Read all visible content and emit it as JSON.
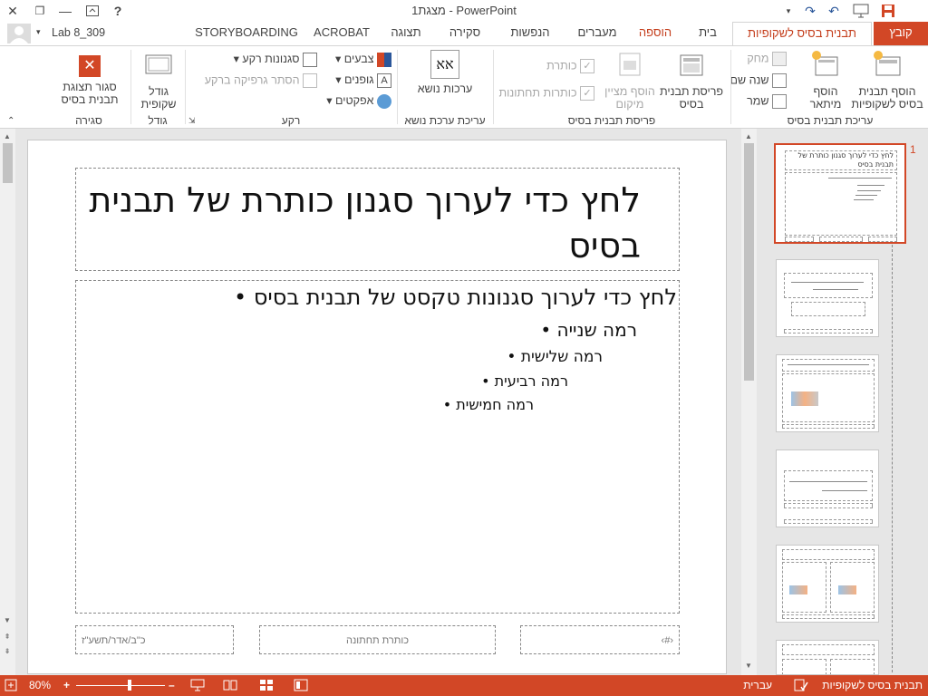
{
  "window": {
    "title": "מצגת1 - PowerPoint",
    "help": "?"
  },
  "user": {
    "name": "Lab 8_309"
  },
  "tabs": [
    {
      "label": "קובץ"
    },
    {
      "label": "תבנית בסיס לשקופיות"
    },
    {
      "label": "בית"
    },
    {
      "label": "הוספה"
    },
    {
      "label": "מעברים"
    },
    {
      "label": "הנפשות"
    },
    {
      "label": "סקירה"
    },
    {
      "label": "תצוגה"
    },
    {
      "label": "ACROBAT"
    },
    {
      "label": "STORYBOARDING"
    }
  ],
  "ribbon": {
    "edit_master": {
      "group_label": "עריכת תבנית בסיס",
      "insert_slide_master": "הוסף תבנית בסיס לשקופיות",
      "insert_layout": "הוסף מיתאר",
      "delete": "מחק",
      "rename": "שנה שם",
      "preserve": "שמר"
    },
    "master_layout": {
      "group_label": "פריסת תבנית בסיס",
      "master_layout": "פריסת תבנית בסיס",
      "insert_placeholder": "הוסף מציין מיקום",
      "title": "כותרת",
      "footers": "כותרות תחתונות"
    },
    "edit_theme": {
      "group_label": "עריכת ערכת נושא",
      "themes": "ערכות נושא",
      "themes_icon_text": "אא"
    },
    "background": {
      "group_label": "רקע",
      "colors": "צבעים",
      "fonts": "גופנים",
      "effects": "אפקטים",
      "background_styles": "סגנונות רקע",
      "hide_bg_graphics": "הסתר גרפיקה ברקע"
    },
    "size": {
      "group_label": "גודל",
      "slide_size": "גודל שקופית"
    },
    "close": {
      "group_label": "סגירה",
      "close_master": "סגור תצוגת תבנית בסיס"
    }
  },
  "slide": {
    "title": "לחץ כדי לערוך סגנון כותרת של תבנית בסיס",
    "bullets": [
      {
        "level": 1,
        "text": "לחץ כדי לערוך סגנונות טקסט של תבנית בסיס"
      },
      {
        "level": 2,
        "text": "רמה שנייה"
      },
      {
        "level": 3,
        "text": "רמה שלישית"
      },
      {
        "level": 4,
        "text": "רמה רביעית"
      },
      {
        "level": 5,
        "text": "רמה חמישית"
      }
    ],
    "footer_date": "כ\"ב/אדר/תשע\"ז",
    "footer_text": "כותרת תחתונה",
    "footer_num": "‹#›"
  },
  "thumbnails": {
    "first_number": "1",
    "thumb_title": "לחץ כדי לערוך סגנון כותרת של תבנית בסיס"
  },
  "status": {
    "view": "תבנית בסיס לשקופיות",
    "language": "עברית",
    "zoom": "80%"
  },
  "colors": {
    "accent": "#d24726",
    "accent_dark": "#c43e1c"
  }
}
